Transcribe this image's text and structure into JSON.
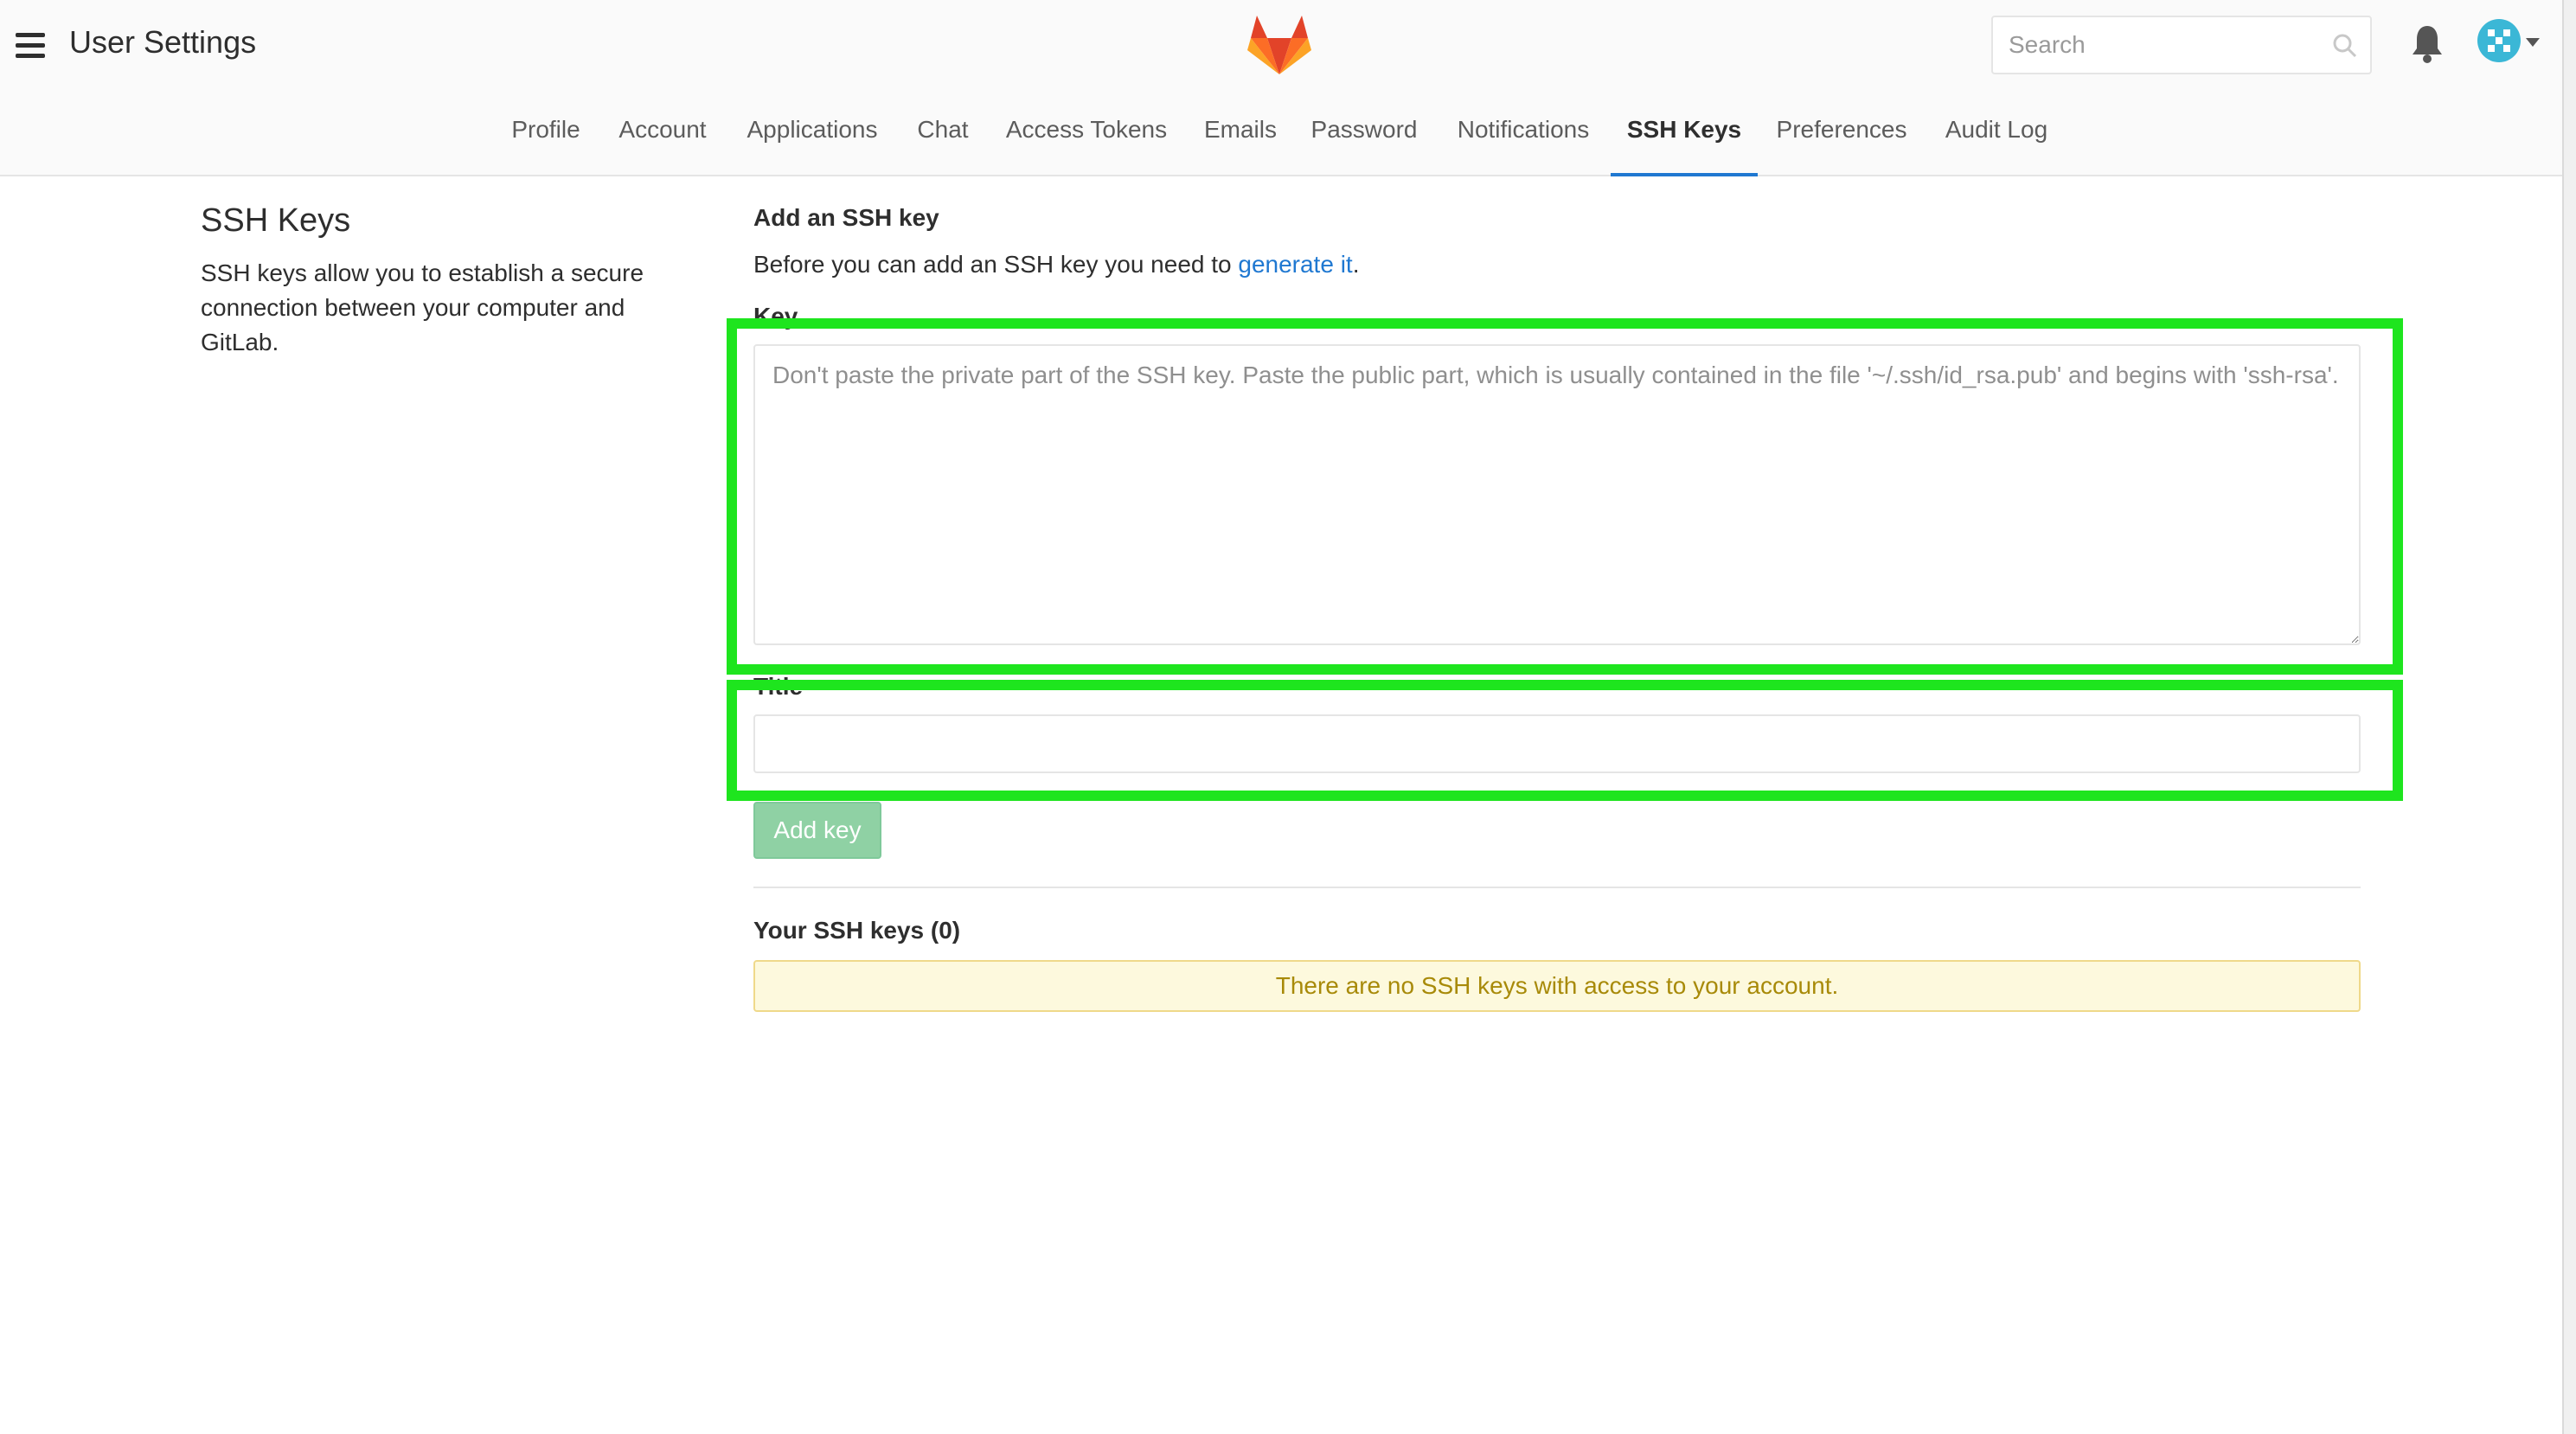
{
  "header": {
    "app_title": "User Settings",
    "search_placeholder": "Search"
  },
  "tabs": [
    {
      "label": "Profile"
    },
    {
      "label": "Account"
    },
    {
      "label": "Applications"
    },
    {
      "label": "Chat"
    },
    {
      "label": "Access Tokens"
    },
    {
      "label": "Emails"
    },
    {
      "label": "Password"
    },
    {
      "label": "Notifications"
    },
    {
      "label": "SSH Keys",
      "active": true
    },
    {
      "label": "Preferences"
    },
    {
      "label": "Audit Log"
    }
  ],
  "sidebar": {
    "title": "SSH Keys",
    "description": "SSH keys allow you to establish a secure connection between your computer and GitLab."
  },
  "form": {
    "heading": "Add an SSH key",
    "instruction_prefix": "Before you can add an SSH key you need to ",
    "instruction_link": "generate it",
    "instruction_suffix": ".",
    "key_label": "Key",
    "key_placeholder": "Don't paste the private part of the SSH key. Paste the public part, which is usually contained in the file '~/.ssh/id_rsa.pub' and begins with 'ssh-rsa'.",
    "title_label": "Title",
    "title_value": "",
    "submit_label": "Add key"
  },
  "keys_list": {
    "heading": "Your SSH keys (0)",
    "empty_message": "There are no SSH keys with access to your account."
  },
  "colors": {
    "highlight": "#1ee51e",
    "link": "#1f78d1",
    "active_tab_underline": "#1f78d1",
    "button_disabled": "#8fd1a4",
    "alert_bg": "#fdf9dd",
    "alert_text": "#a88a09"
  },
  "icons": [
    "menu-icon",
    "gitlab-logo",
    "search-icon",
    "bell-icon",
    "avatar",
    "chevron-down-icon"
  ]
}
